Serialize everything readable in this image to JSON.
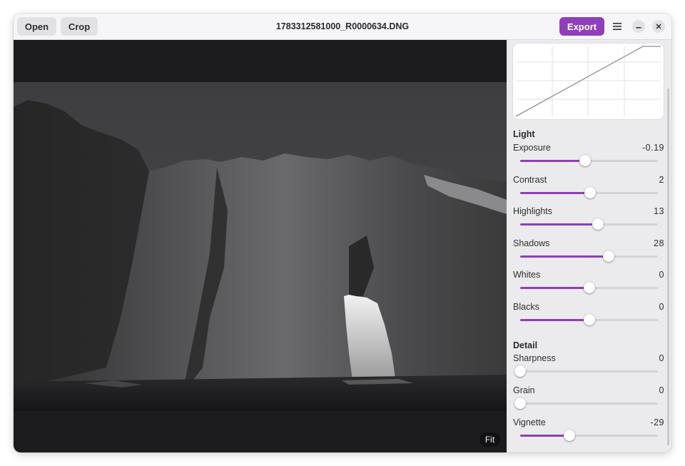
{
  "header": {
    "open_label": "Open",
    "crop_label": "Crop",
    "title": "1783312581000_R0000634.DNG",
    "export_label": "Export"
  },
  "icons": {
    "menu": "hamburger-menu-icon",
    "minimize": "minimize-icon",
    "close": "close-icon"
  },
  "colors": {
    "accent": "#8f3fb8",
    "canvas": "#1c1c1e"
  },
  "canvas": {
    "fit_label": "Fit"
  },
  "panel": {
    "light": {
      "title": "Light",
      "adjustments": [
        {
          "label": "Exposure",
          "value": "-0.19",
          "position": 0.47
        },
        {
          "label": "Contrast",
          "value": "2",
          "position": 0.51
        },
        {
          "label": "Highlights",
          "value": "13",
          "position": 0.565
        },
        {
          "label": "Shadows",
          "value": "28",
          "position": 0.64
        },
        {
          "label": "Whites",
          "value": "0",
          "position": 0.5
        },
        {
          "label": "Blacks",
          "value": "0",
          "position": 0.5
        }
      ]
    },
    "detail": {
      "title": "Detail",
      "adjustments": [
        {
          "label": "Sharpness",
          "value": "0",
          "position": 0
        },
        {
          "label": "Grain",
          "value": "0",
          "position": 0
        },
        {
          "label": "Vignette",
          "value": "-29",
          "position": 0.355
        }
      ]
    }
  }
}
